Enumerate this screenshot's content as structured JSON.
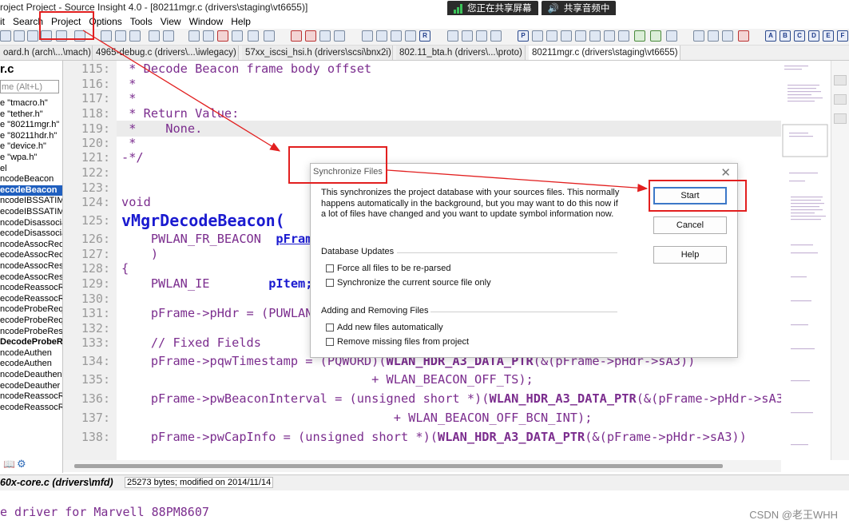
{
  "window": {
    "title": "roject Project - Source Insight 4.0 - [80211mgr.c (drivers\\staging\\vt6655)]"
  },
  "share": {
    "screen_label": "您正在共享屏幕",
    "audio_label": "共享音频中"
  },
  "menu": [
    "it",
    "Search",
    "Project",
    "Options",
    "Tools",
    "View",
    "Window",
    "Help"
  ],
  "tabs": [
    "oard.h (arch\\...\\mach)",
    "4965-debug.c (drivers\\...\\iwlegacy)",
    "57xx_iscsi_hsi.h (drivers\\scsi\\bnx2i)",
    "802.11_bta.h (drivers\\...\\proto)",
    "80211mgr.c (drivers\\staging\\vt6655)"
  ],
  "sidebar": {
    "title": "r.c",
    "search_placeholder": "me (Alt+L)",
    "symbols": [
      "e \"tmacro.h\"",
      "e \"tether.h\"",
      "e \"80211mgr.h\"",
      "e \"80211hdr.h\"",
      "e \"device.h\"",
      "e \"wpa.h\"",
      "el",
      "ncodeBeacon",
      "ecodeBeacon",
      "ncodeIBSSATIM",
      "ecodeIBSSATIM",
      "ncodeDisassocia",
      "ecodeDisassocia",
      "ncodeAssocReq",
      "ecodeAssocReq",
      "ncodeAssocResp",
      "ecodeAssocRes",
      "ncodeReassocRe",
      "ecodeReassocR",
      "ncodeProbeReq",
      "ecodeProbeReq",
      "ncodeProbeRes",
      "DecodeProbeRe",
      "ncodeAuthen",
      "ecodeAuthen",
      "ncodeDeauthen",
      "ecodeDeauther",
      "ncodeReassocRe",
      "ecodeReassocR"
    ]
  },
  "editor": {
    "line_numbers": [
      "115:",
      "116:",
      "117:",
      "118:",
      "119:",
      "120:",
      "121:",
      "122:",
      "123:",
      "124:",
      "125:",
      "126:",
      "127:",
      "128:",
      "129:",
      "130:",
      "131:",
      "132:",
      "133:",
      "134:",
      "135:",
      "136:",
      "137:",
      "138:"
    ],
    "lines": {
      "l115": " * Decode Beacon frame body offset",
      "l116": " *",
      "l117": " *",
      "l118": " * Return Value:",
      "l119": " *    None.",
      "l120": " *",
      "l121": "-*/",
      "l124": "void",
      "l125": "vMgrDecodeBeacon(",
      "l126a": "    PWLAN_FR_BEACON  ",
      "l126b": "pFrame",
      "l127": "    )",
      "l128": "{",
      "l129a": "    PWLAN_IE        ",
      "l129b": "pItem;",
      "l131": "    pFrame->pHdr = (PUWLAN_",
      "l133": "    // Fixed Fields",
      "l134a": "    pFrame->pqwTimestamp = (PQWORD)(",
      "l134b": "WLAN_HDR_A3_DATA_PTR",
      "l134c": "(&(pFrame->pHdr->sA3))",
      "l135": "                                  + WLAN_BEACON_OFF_TS);",
      "l136a": "    pFrame->pwBeaconInterval = (unsigned short *)(",
      "l136b": "WLAN_HDR_A3_DATA_PTR",
      "l136c": "(&(pFrame->pHdr->sA3)",
      "l137": "                                     + WLAN_BEACON_OFF_BCN_INT);",
      "l138a": "    pFrame->pwCapInfo = (unsigned short *)(",
      "l138b": "WLAN_HDR_A3_DATA_PTR",
      "l138c": "(&(pFrame->pHdr->sA3))"
    }
  },
  "status": {
    "file": "60x-core.c (drivers\\mfd)",
    "info": "25273 bytes; modified on 2014/11/14"
  },
  "preview": {
    "text": "e driver for Marvell 88PM8607"
  },
  "watermark": "CSDN @老王WHH",
  "dialog": {
    "title": "Synchronize Files",
    "description": "This synchronizes the project database with your sources files. This normally happens automatically in the background, but you may want to do this now if a lot of files have changed and you want to update symbol information now.",
    "buttons": {
      "start": "Start",
      "cancel": "Cancel",
      "help": "Help"
    },
    "database_updates": {
      "label": "Database Updates",
      "options": [
        "Force all files to be re-parsed",
        "Synchronize the current source file only"
      ]
    },
    "adding_removing": {
      "label": "Adding and Removing Files",
      "options": [
        "Add new files automatically",
        "Remove missing files from project"
      ]
    }
  },
  "colors": {
    "selection": "#1f5fbf",
    "annotation": "#e21f1f",
    "keyword": "#7b2d8e",
    "identifier": "#1a1ad0"
  }
}
